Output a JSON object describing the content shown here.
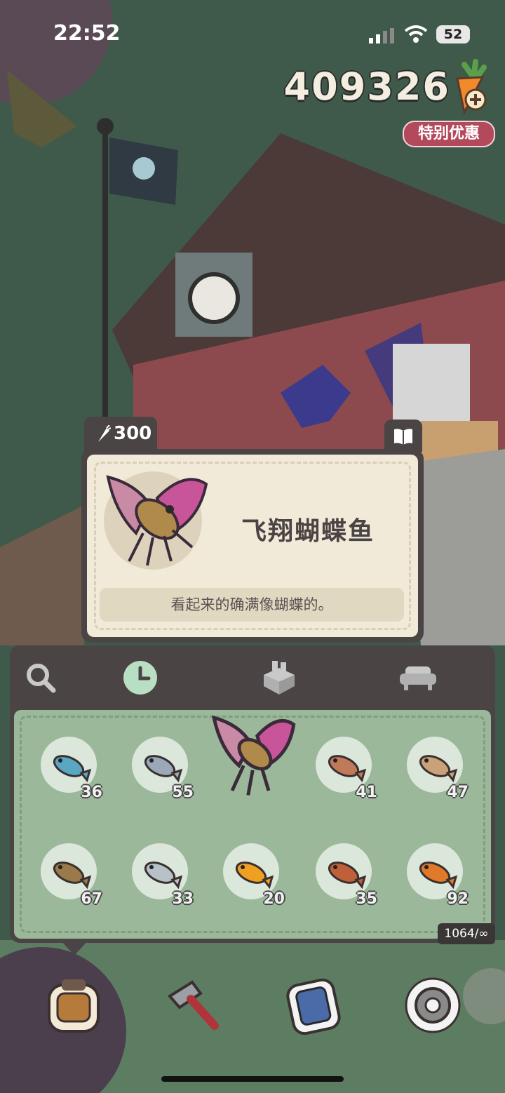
{
  "status_bar": {
    "time": "22:52",
    "battery": "52"
  },
  "header": {
    "currency_amount": "409326",
    "currency_icon": "carrot-plus-icon",
    "special_offer_label": "特别优惠"
  },
  "item_card": {
    "price": "300",
    "price_icon": "carrot-icon",
    "book_icon": "book-icon",
    "name": "飞翔蝴蝶鱼",
    "description": "看起来的确满像蝴蝶的。"
  },
  "panel": {
    "tabs": [
      {
        "icon": "magnifier-icon",
        "selected": false
      },
      {
        "icon": "clock-icon",
        "selected": true
      },
      {
        "icon": "box-icon",
        "selected": false
      },
      {
        "icon": "sofa-icon",
        "selected": false
      }
    ],
    "items": [
      {
        "name": "neon-tetra",
        "count": "36"
      },
      {
        "name": "silver-tetra",
        "count": "55"
      },
      {
        "name": "flying-butterfly-fish",
        "count": "",
        "selected": true
      },
      {
        "name": "piranha",
        "count": "41"
      },
      {
        "name": "hermit-crab",
        "count": "47"
      },
      {
        "name": "toad-fish",
        "count": "67"
      },
      {
        "name": "sardine",
        "count": "33"
      },
      {
        "name": "goldfish",
        "count": "20"
      },
      {
        "name": "perch",
        "count": "35"
      },
      {
        "name": "koi",
        "count": "92"
      }
    ],
    "capacity": "1064/∞"
  },
  "bottom_nav": [
    {
      "icon": "backpack-icon"
    },
    {
      "icon": "hammer-icon"
    },
    {
      "icon": "phone-icon"
    },
    {
      "icon": "gear-icon"
    }
  ],
  "colors": {
    "panel": "#4a4444",
    "grid": "#9bb89a",
    "card": "#f1ead8",
    "offer": "#b24a5c"
  }
}
